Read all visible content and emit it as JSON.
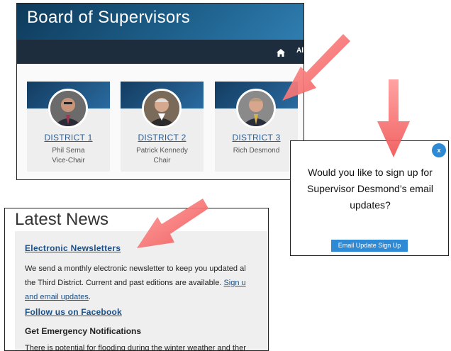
{
  "board": {
    "title": "Board of Supervisors",
    "nav_text": "Al",
    "districts": [
      {
        "link": "DISTRICT 1",
        "name": "Phil Serna",
        "role": "Vice-Chair"
      },
      {
        "link": "DISTRICT 2",
        "name": "Patrick Kennedy",
        "role": "Chair"
      },
      {
        "link": "DISTRICT 3",
        "name": "Rich Desmond",
        "role": ""
      }
    ]
  },
  "popup": {
    "close_label": "x",
    "message": "Would you like to sign up for Supervisor Desmond’s email updates?",
    "button_label": "Email Update Sign Up"
  },
  "news": {
    "title": "Latest News",
    "link_newsletters": "Electronic Newsletters",
    "para_line1": "We send a monthly electronic newsletter to keep you updated al",
    "para_line2_text": "the Third District. Current and past editions are available. ",
    "para_line2_link": "Sign u",
    "para_line3_link": "and email updates",
    "para_line3_end": ".",
    "link_facebook": "Follow us on Facebook",
    "heading_emergency": "Get Emergency Notifications",
    "para_last": "There is potential for flooding during the winter weather and ther"
  },
  "icons": {
    "home": "home-icon",
    "arrow": "arrow-icon",
    "photo": "person-photo"
  },
  "colors": {
    "header_blue": "#1d5f8a",
    "nav_dark": "#1e2d3d",
    "link_blue": "#2a5f99",
    "button_blue": "#2f8ad6",
    "arrow_red": "#f26e6e"
  }
}
